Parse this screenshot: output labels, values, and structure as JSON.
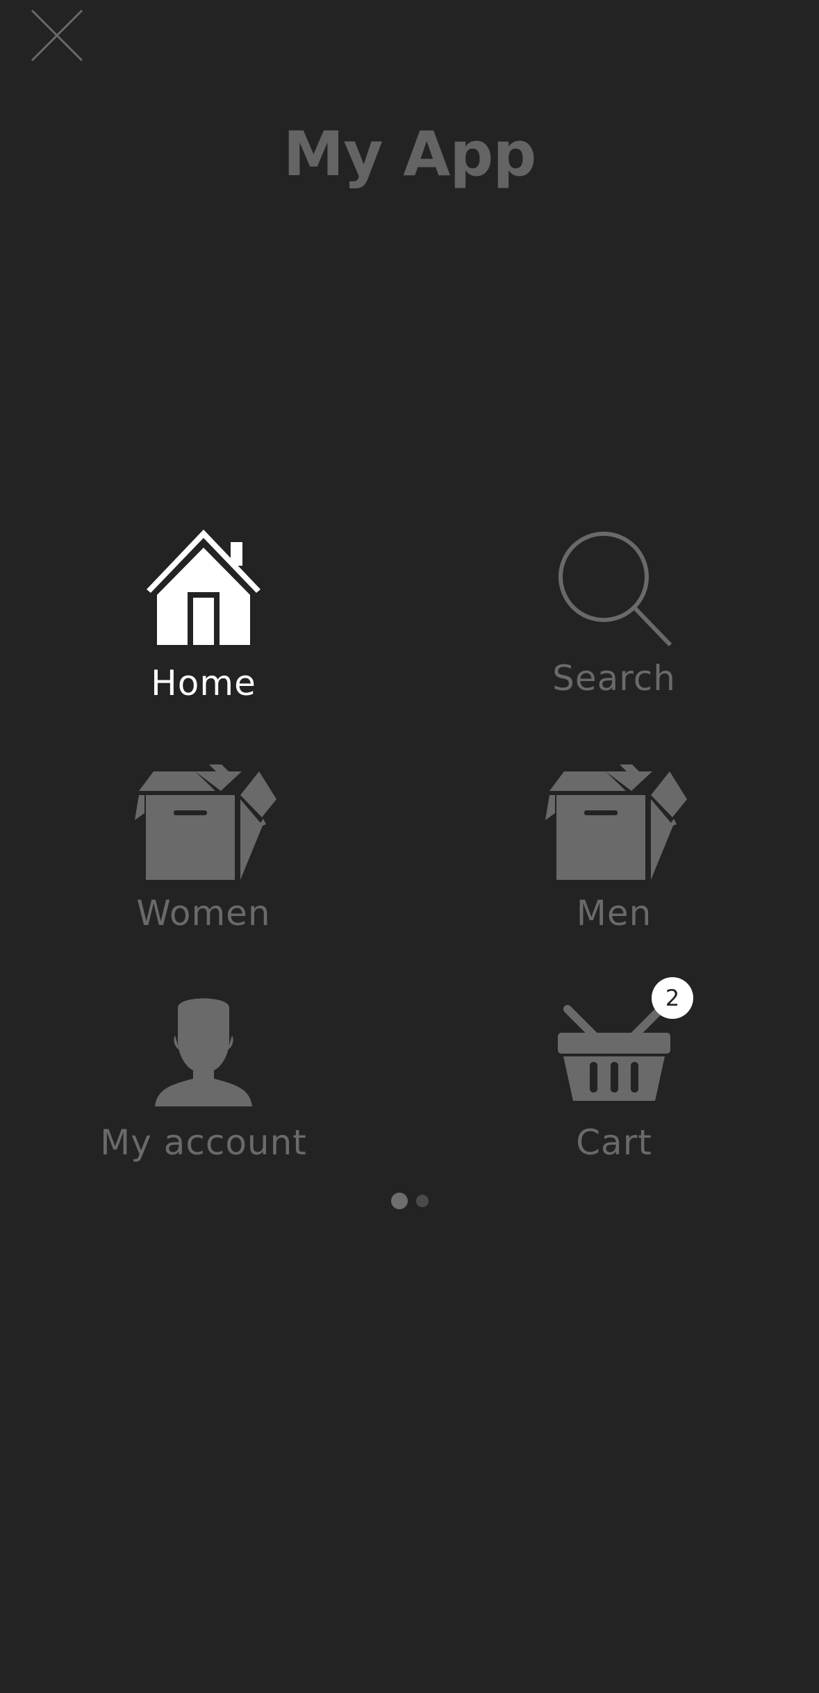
{
  "app": {
    "title": "My App"
  },
  "close_button": {
    "icon": "close-icon"
  },
  "menu": {
    "items": [
      {
        "label": "Home",
        "icon": "home-icon",
        "active": true
      },
      {
        "label": "Search",
        "icon": "search-icon",
        "active": false
      },
      {
        "label": "Women",
        "icon": "box-icon",
        "active": false
      },
      {
        "label": "Men",
        "icon": "box-icon",
        "active": false
      },
      {
        "label": "My account",
        "icon": "user-icon",
        "active": false
      },
      {
        "label": "Cart",
        "icon": "basket-icon",
        "active": false,
        "badge": "2"
      }
    ]
  },
  "pager": {
    "pages": 2,
    "current": 1
  },
  "colors": {
    "background": "#232323",
    "icon_inactive": "#6a6a6a",
    "icon_active": "#ffffff",
    "badge_bg": "#ffffff"
  }
}
